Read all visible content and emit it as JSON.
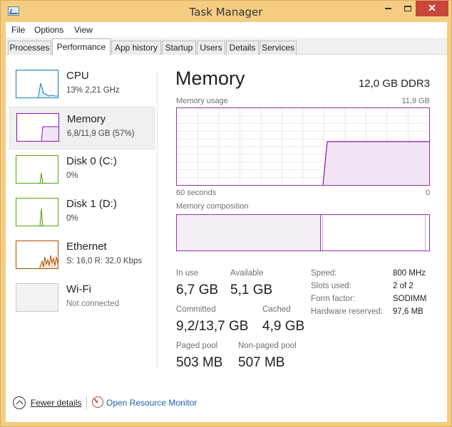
{
  "window": {
    "title": "Task Manager",
    "close_glyph": "✕"
  },
  "menu": [
    "File",
    "Options",
    "View"
  ],
  "tabs": [
    "Processes",
    "Performance",
    "App history",
    "Startup",
    "Users",
    "Details",
    "Services"
  ],
  "active_tab": "Performance",
  "sidebar": [
    {
      "name": "CPU",
      "sub": "13%  2,21 GHz",
      "color": "#117dbb"
    },
    {
      "name": "Memory",
      "sub": "6,8/11,9 GB (57%)",
      "color": "#8b12ae",
      "selected": true
    },
    {
      "name": "Disk 0 (C:)",
      "sub": "0%",
      "color": "#4da60c"
    },
    {
      "name": "Disk 1 (D:)",
      "sub": "0%",
      "color": "#4da60c"
    },
    {
      "name": "Ethernet",
      "sub": "S: 16,0  R: 32,0 Kbps",
      "color": "#a74f01"
    },
    {
      "name": "Wi-Fi",
      "sub": "Not connected",
      "color": "#a0a0a0"
    }
  ],
  "memory": {
    "title": "Memory",
    "capacity": "12,0 GB DDR3",
    "usage_label": "Memory usage",
    "usage_max": "11,9 GB",
    "time_left": "60 seconds",
    "time_right": "0",
    "composition_label": "Memory composition",
    "in_use_label": "In use",
    "in_use": "6,7 GB",
    "available_label": "Available",
    "available": "5,1 GB",
    "committed_label": "Committed",
    "committed": "9,2/13,7 GB",
    "cached_label": "Cached",
    "cached": "4,9 GB",
    "paged_label": "Paged pool",
    "paged": "503 MB",
    "nonpaged_label": "Non-paged pool",
    "nonpaged": "507 MB",
    "props": [
      {
        "label": "Speed:",
        "value": "800 MHz"
      },
      {
        "label": "Slots used:",
        "value": "2 of 2"
      },
      {
        "label": "Form factor:",
        "value": "SODIMM"
      },
      {
        "label": "Hardware reserved:",
        "value": "97,6 MB"
      }
    ]
  },
  "footer": {
    "fewer": "Fewer details",
    "resource_monitor": "Open Resource Monitor"
  }
}
